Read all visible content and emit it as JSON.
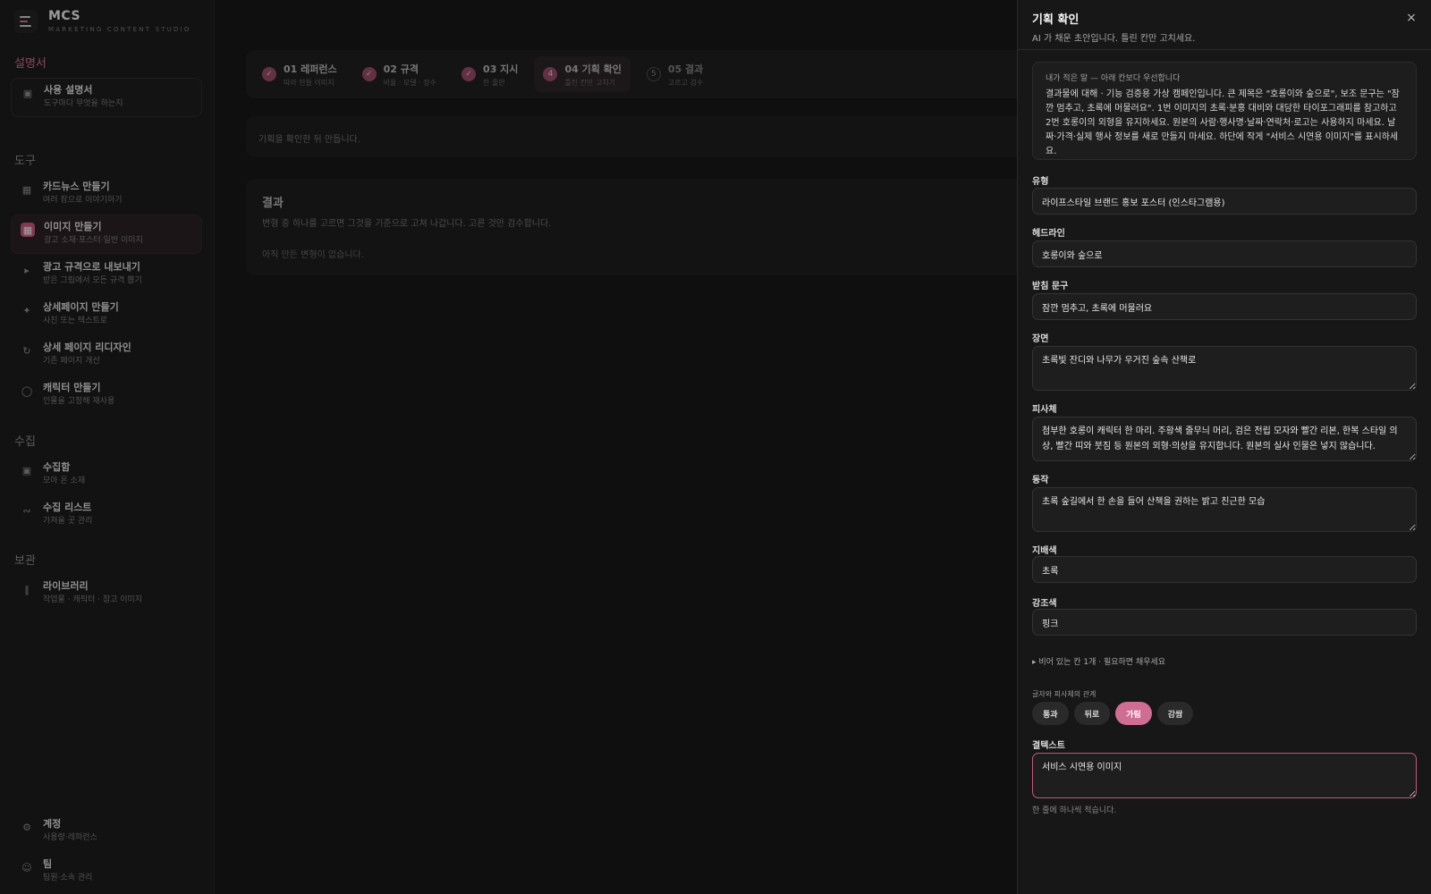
{
  "brand": {
    "name": "MCS",
    "sub": "MARKETING CONTENT STUDIO"
  },
  "sidebar": {
    "sections": {
      "guide": "설명서",
      "tools": "도구",
      "collect": "수집",
      "archive": "보관"
    },
    "guide_item": {
      "label": "사용 설명서",
      "sub": "도구마다 무엇을 하는지"
    },
    "tools": [
      {
        "label": "카드뉴스 만들기",
        "sub": "여러 장으로 이야기하기"
      },
      {
        "label": "이미지 만들기",
        "sub": "광고 소재·포스터·일반 이미지"
      },
      {
        "label": "광고 규격으로 내보내기",
        "sub": "받은 그림에서 모든 규격 뽑기"
      },
      {
        "label": "상세페이지 만들기",
        "sub": "사진 또는 텍스트로"
      },
      {
        "label": "상세 페이지 리디자인",
        "sub": "기존 페이지 개선"
      },
      {
        "label": "캐릭터 만들기",
        "sub": "인물을 고정해 재사용"
      }
    ],
    "collect": [
      {
        "label": "수집함",
        "sub": "모아 온 소재"
      },
      {
        "label": "수집 리스트",
        "sub": "가져올 곳 관리"
      }
    ],
    "archive": [
      {
        "label": "라이브러리",
        "sub": "작업물 · 캐릭터 · 참고 이미지"
      }
    ],
    "bottom": [
      {
        "label": "계정",
        "sub": "사용량·레퍼런스"
      },
      {
        "label": "팀",
        "sub": "팀원·소속 관리"
      }
    ]
  },
  "steps": [
    {
      "num": "1",
      "title": "01 레퍼런스",
      "sub": "따라 만들 이미지",
      "state": "done"
    },
    {
      "num": "2",
      "title": "02 규격",
      "sub": "비율 · 모델 · 장수",
      "state": "done"
    },
    {
      "num": "3",
      "title": "03 지시",
      "sub": "한 줄만",
      "state": "done"
    },
    {
      "num": "4",
      "title": "04 기획 확인",
      "sub": "틀린 칸만 고치기",
      "state": "current"
    },
    {
      "num": "5",
      "title": "05 결과",
      "sub": "고르고 검수",
      "state": "pending"
    }
  ],
  "main": {
    "notice": "기획을 확인한 뒤 만듭니다.",
    "result_title": "결과",
    "result_desc": "변형 중 하나를 고르면 그것을 기준으로 고쳐 나갑니다. 고른 것만 검수합니다.",
    "result_empty": "아직 만든 변형이 없습니다."
  },
  "drawer": {
    "title": "기획 확인",
    "subtitle": "AI 가 채운 초안입니다. 틀린 칸만 고치세요.",
    "close": "×",
    "memo_label": "내가 적은 말 — 아래 칸보다 우선합니다",
    "memo_text": "결과물에 대해 · 기능 검증용 가상 캠페인입니다. 큰 제목은 \"호롱이와 숲으로\", 보조 문구는 \"잠깐 멈추고, 초록에 머물러요\". 1번 이미지의 초록·분홍 대비와 대담한 타이포그래피를 참고하고 2번 호롱이의 외형을 유지하세요. 원본의 사람·행사명·날짜·연락처·로고는 사용하지 마세요. 날짜·가격·실제 행사 정보를 새로 만들지 마세요. 하단에 작게 \"서비스 시연용 이미지\"를 표시하세요.",
    "fields": {
      "type_label": "유형",
      "type_value": "라이프스타일 브랜드 홍보 포스터 (인스타그램용)",
      "headline_label": "헤드라인",
      "headline_value": "호롱이와 숲으로",
      "support_label": "받침 문구",
      "support_value": "잠깐 멈추고, 초록에 머물러요",
      "scene_label": "장면",
      "scene_value": "초록빛 잔디와 나무가 우거진 숲속 산책로",
      "subject_label": "피사체",
      "subject_value": "첨부한 호롱이 캐릭터 한 마리. 주황색 줄무늬 머리, 검은 전립 모자와 빨간 리본, 한복 스타일 의상, 빨간 띠와 붓짐 등 원본의 외형·의상을 유지합니다. 원본의 실사 인물은 넣지 않습니다.",
      "action_label": "동작",
      "action_value": "초록 숲길에서 한 손을 들어 산책을 권하는 밝고 친근한 모습",
      "dominant_label": "지배색",
      "dominant_value": "초록",
      "accent_label": "강조색",
      "accent_value": "핑크"
    },
    "expander": "▸ 비어 있는 칸 1개 · 필요하면 채우세요",
    "relation_label": "글자와 피사체의 관계",
    "relation_options": [
      "통과",
      "뒤로",
      "가림",
      "감쌈"
    ],
    "relation_selected": "가림",
    "must_text_label": "결텍스트",
    "must_text_value": "서비스 시연용 이미지",
    "helper": "한 줄에 하나씩 적습니다."
  },
  "colors": {
    "accent": "#d06d92",
    "background": "#0f0f0f",
    "panel": "#171717"
  }
}
